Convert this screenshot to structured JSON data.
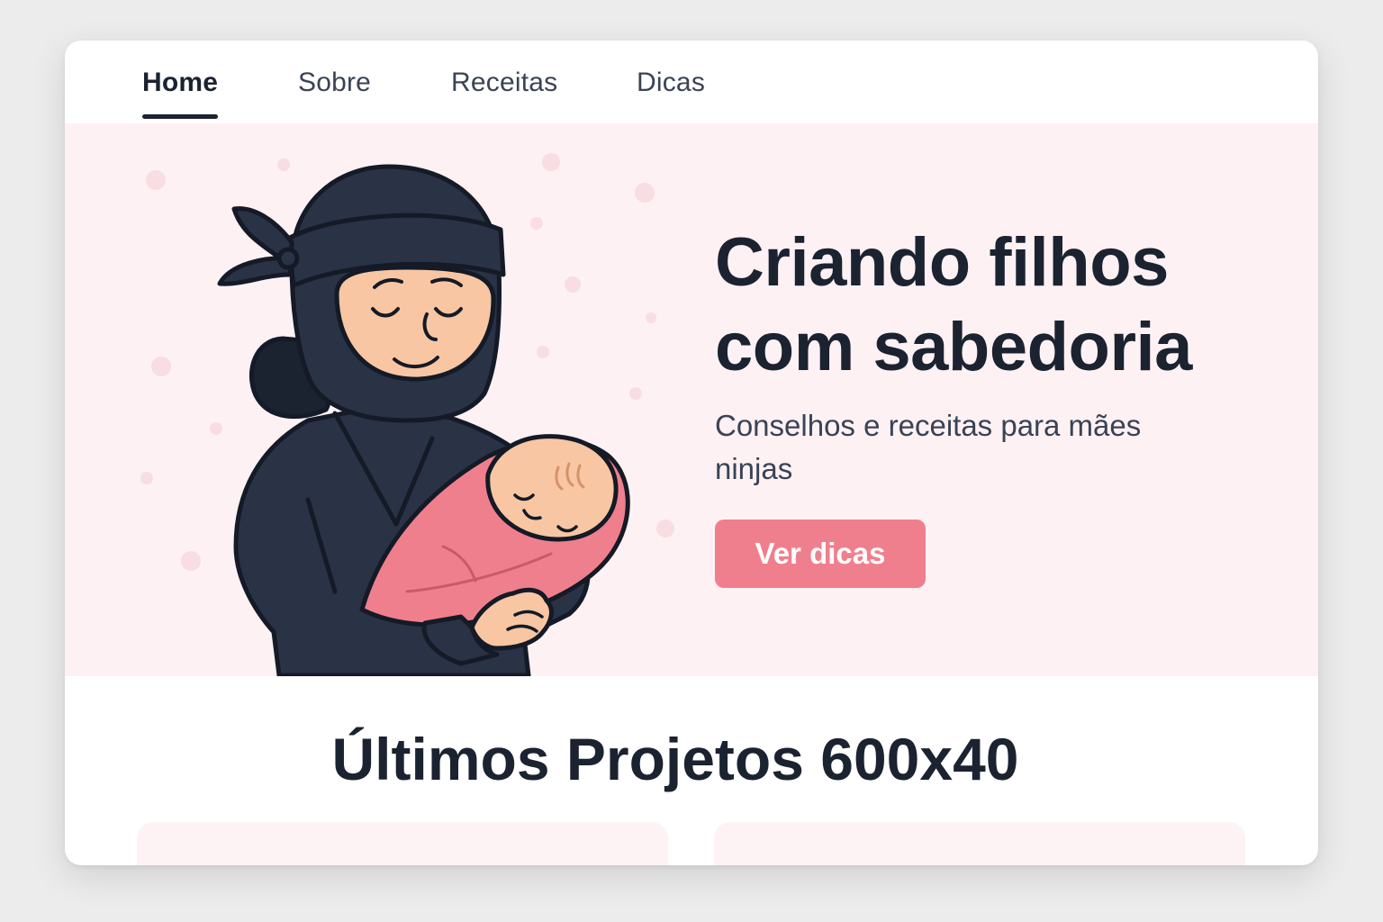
{
  "nav": {
    "items": [
      {
        "label": "Home",
        "active": true
      },
      {
        "label": "Sobre",
        "active": false
      },
      {
        "label": "Receitas",
        "active": false
      },
      {
        "label": "Dicas",
        "active": false
      }
    ]
  },
  "hero": {
    "title": "Criando filhos com sabedoria",
    "subtitle": "Conselhos e receitas para mães ninjas",
    "cta_label": "Ver dicas",
    "illustration_icon": "ninja-mother-holding-baby-illustration"
  },
  "section": {
    "title": "Últimos Projetos 600x40"
  },
  "colors": {
    "accent": "#f07f8d",
    "hero_background": "#fdf1f3",
    "text_dark": "#1b2230",
    "ninja_outfit": "#2a3245"
  }
}
